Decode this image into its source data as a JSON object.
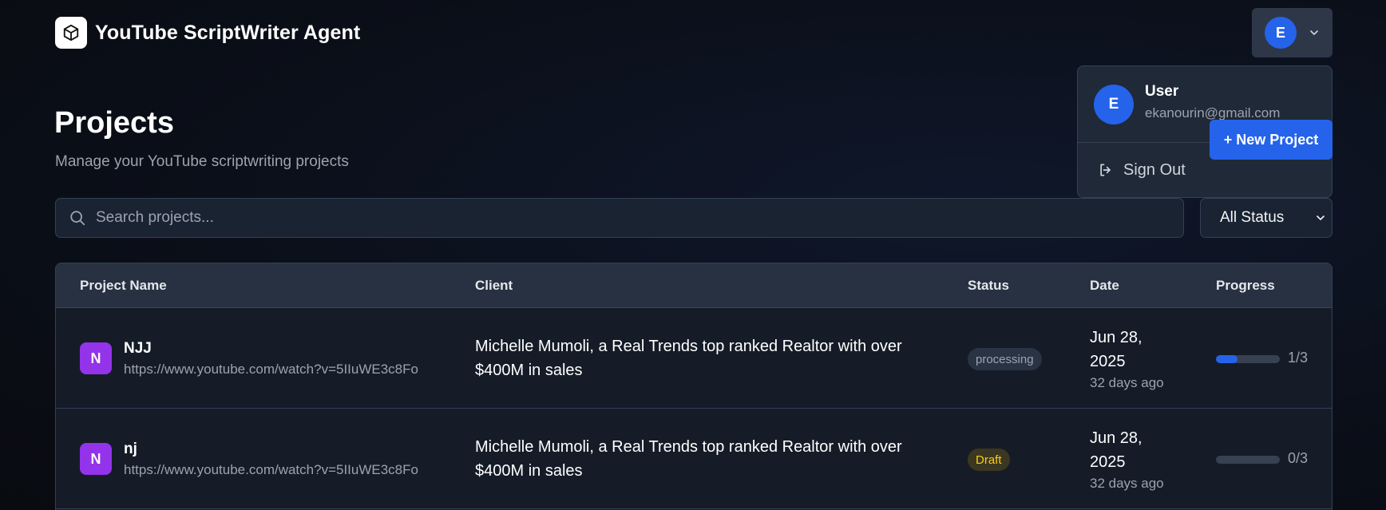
{
  "app": {
    "title": "YouTube ScriptWriter Agent",
    "logo_icon": "cube-icon"
  },
  "user": {
    "initial": "E",
    "name": "User",
    "email": "ekanourin@gmail.com",
    "sign_out_label": "Sign Out"
  },
  "page": {
    "title": "Projects",
    "subtitle": "Manage your YouTube scriptwriting projects",
    "new_project_label": "+ New Project"
  },
  "search": {
    "placeholder": "Search projects..."
  },
  "filter": {
    "selected": "All Status"
  },
  "table": {
    "headers": {
      "name": "Project Name",
      "client": "Client",
      "status": "Status",
      "date": "Date",
      "progress": "Progress"
    },
    "rows": [
      {
        "initial": "N",
        "name": "NJJ",
        "url": "https://www.youtube.com/watch?v=5IIuWE3c8Fo",
        "client": "Michelle Mumoli, a Real Trends top ranked Realtor with over $400M in sales",
        "status": "processing",
        "date": "Jun 28, 2025",
        "ago": "32 days ago",
        "progress_fraction": 0.333,
        "progress_text": "1/3"
      },
      {
        "initial": "N",
        "name": "nj",
        "url": "https://www.youtube.com/watch?v=5IIuWE3c8Fo",
        "client": "Michelle Mumoli, a Real Trends top ranked Realtor with over $400M in sales",
        "status": "Draft",
        "date": "Jun 28, 2025",
        "ago": "32 days ago",
        "progress_fraction": 0,
        "progress_text": "0/3"
      }
    ]
  },
  "colors": {
    "accent": "#2563eb",
    "project_avatar": "#9333ea",
    "draft_text": "#facc15"
  }
}
